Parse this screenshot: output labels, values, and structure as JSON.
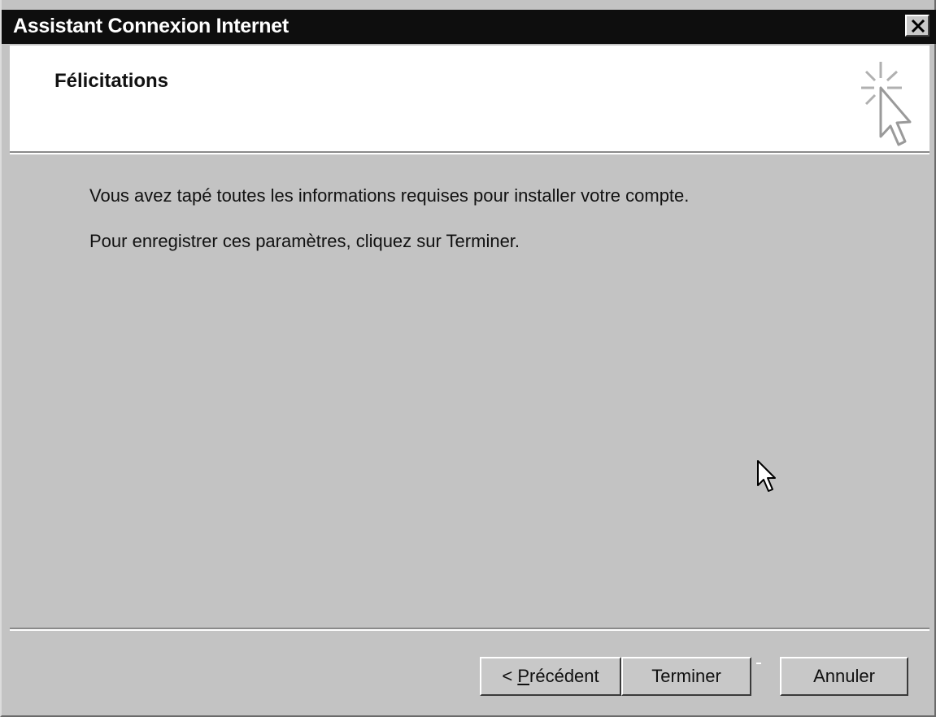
{
  "window": {
    "title": "Assistant Connexion Internet",
    "close_icon": "close-icon"
  },
  "header": {
    "title": "Félicitations",
    "icon": "wizard-cursor-icon"
  },
  "body": {
    "line1": "Vous avez tapé toutes les informations requises pour installer votre compte.",
    "line2": "Pour enregistrer ces paramètres, cliquez sur Terminer."
  },
  "buttons": {
    "previous_prefix": "< ",
    "previous_mnemonic": "P",
    "previous_rest": "récédent",
    "finish": "Terminer",
    "cancel": "Annuler"
  },
  "colors": {
    "titlebar": "#0e0e0e",
    "dialog_background": "#c3c3c3",
    "header_background": "#ffffff"
  }
}
